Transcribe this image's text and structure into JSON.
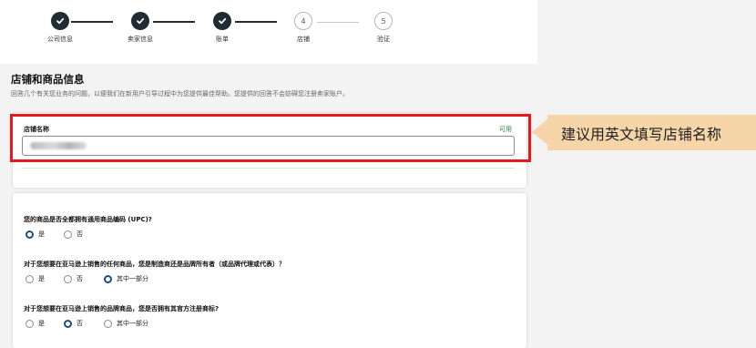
{
  "stepper": {
    "steps": [
      {
        "number": "",
        "label": "公司信息",
        "state": "done"
      },
      {
        "number": "",
        "label": "卖家信息",
        "state": "done"
      },
      {
        "number": "",
        "label": "账单",
        "state": "done"
      },
      {
        "number": "4",
        "label": "店铺",
        "state": "todo"
      },
      {
        "number": "5",
        "label": "验证",
        "state": "todo"
      }
    ]
  },
  "section": {
    "title": "店铺和商品信息",
    "description": "回答几个有关您业务的问题，以便我们在新用户引导过程中为您提供最佳帮助。您提供的回答不会妨碍您注册卖家账户。"
  },
  "store_name": {
    "label": "店铺名称",
    "status": "可用",
    "value": ""
  },
  "callout": {
    "text": "建议用英文填写店铺名称"
  },
  "questions": [
    {
      "text": "您的商品是否全都拥有通用商品编码 (UPC)?",
      "options": [
        "是",
        "否"
      ],
      "selected": "是"
    },
    {
      "text": "对于您想要在亚马逊上销售的任何商品，您是制造商还是品牌所有者（或品牌代理或代表）？",
      "options": [
        "是",
        "否",
        "其中一部分"
      ],
      "selected": "其中一部分"
    },
    {
      "text": "对于您想要在亚马逊上销售的品牌商品，您是否拥有其官方注册商标?",
      "options": [
        "是",
        "否",
        "其中一部分"
      ],
      "selected": "否"
    }
  ],
  "colors": {
    "done_step": "#1f2d33",
    "available": "#2a8a43",
    "highlight_border": "#e8191b",
    "callout_bg": "#f6d6a9",
    "radio_selected": "#1f4e7a"
  },
  "icons": {
    "done_step": "check-icon",
    "radio": "radio-icon"
  }
}
